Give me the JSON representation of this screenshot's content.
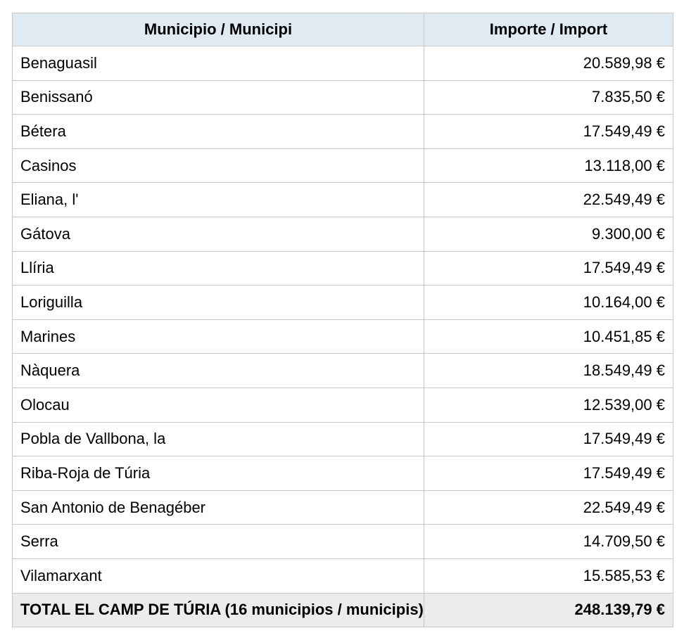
{
  "table": {
    "headers": {
      "municipality": "Municipio / Municipi",
      "amount": "Importe / Import"
    },
    "rows": [
      {
        "municipality": "Benaguasil",
        "amount": "20.589,98 €"
      },
      {
        "municipality": "Benissanó",
        "amount": "7.835,50 €"
      },
      {
        "municipality": "Bétera",
        "amount": "17.549,49 €"
      },
      {
        "municipality": "Casinos",
        "amount": "13.118,00 €"
      },
      {
        "municipality": "Eliana, l'",
        "amount": "22.549,49 €"
      },
      {
        "municipality": "Gátova",
        "amount": "9.300,00 €"
      },
      {
        "municipality": "Llíria",
        "amount": "17.549,49 €"
      },
      {
        "municipality": "Loriguilla",
        "amount": "10.164,00 €"
      },
      {
        "municipality": "Marines",
        "amount": "10.451,85 €"
      },
      {
        "municipality": "Nàquera",
        "amount": "18.549,49 €"
      },
      {
        "municipality": "Olocau",
        "amount": "12.539,00 €"
      },
      {
        "municipality": "Pobla de Vallbona, la",
        "amount": "17.549,49 €"
      },
      {
        "municipality": "Riba-Roja de Túria",
        "amount": "17.549,49 €"
      },
      {
        "municipality": "San Antonio de Benagéber",
        "amount": "22.549,49 €"
      },
      {
        "municipality": "Serra",
        "amount": "14.709,50 €"
      },
      {
        "municipality": "Vilamarxant",
        "amount": "15.585,53 €"
      }
    ],
    "total": {
      "label": "TOTAL EL CAMP DE TÚRIA (16 municipios / municipis)",
      "amount": "248.139,79 €"
    }
  }
}
